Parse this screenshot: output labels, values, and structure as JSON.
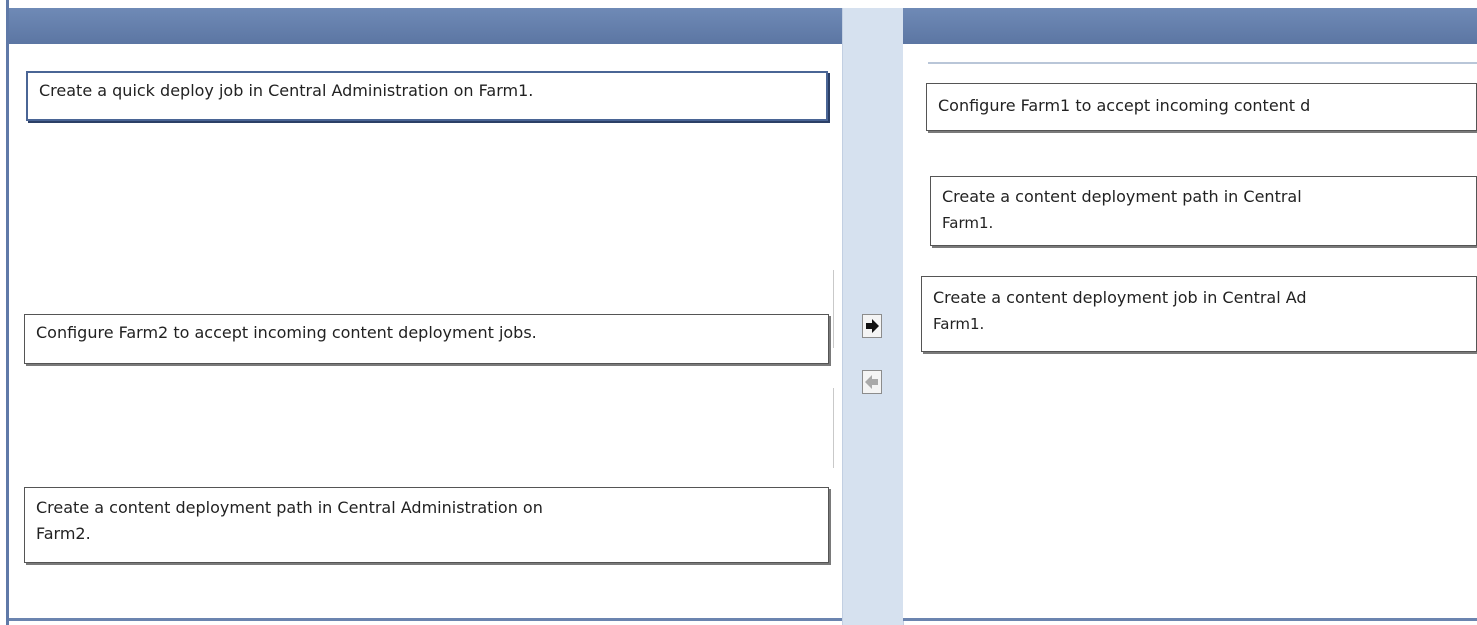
{
  "left_list": {
    "items": [
      {
        "label": "Create a quick deploy job in Central Administration on Farm1."
      },
      {
        "label": "Configure Farm2 to accept incoming content deployment jobs."
      },
      {
        "label": "Create a content deployment path in Central Administration on",
        "label2": "Farm2."
      }
    ]
  },
  "right_list": {
    "items": [
      {
        "label": "Configure Farm1 to accept incoming content d"
      },
      {
        "label": "Create a content deployment path in Central",
        "label2": "Farm1."
      },
      {
        "label": "Create a content deployment job in Central Ad",
        "label2": "Farm1."
      }
    ]
  },
  "controls": {
    "move_right_icon": "arrow-right-icon",
    "move_left_icon": "arrow-left-icon"
  },
  "colors": {
    "header": "#5f79a8",
    "middle_strip": "#d6e1ef",
    "item_border": "#555555"
  }
}
